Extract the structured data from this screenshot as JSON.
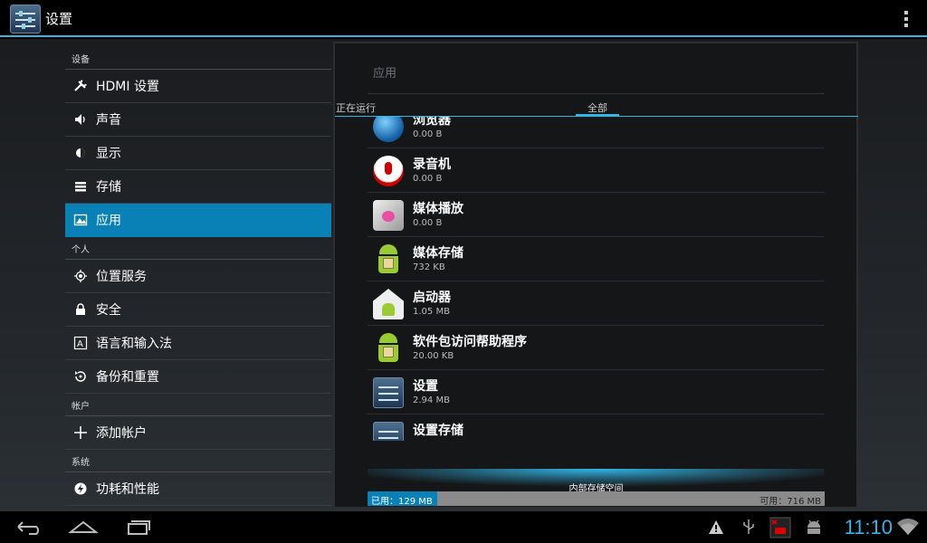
{
  "action_bar": {
    "title": "设置"
  },
  "left_list": {
    "sections": [
      {
        "header": "设备",
        "items": [
          {
            "label": "HDMI 设置",
            "icon": "wrench-icon"
          },
          {
            "label": "声音",
            "icon": "speaker-icon"
          },
          {
            "label": "显示",
            "icon": "brightness-icon"
          },
          {
            "label": "存储",
            "icon": "storage-icon"
          },
          {
            "label": "应用",
            "icon": "apps-icon",
            "selected": true
          }
        ]
      },
      {
        "header": "个人",
        "items": [
          {
            "label": "位置服务",
            "icon": "location-icon"
          },
          {
            "label": "安全",
            "icon": "lock-icon"
          },
          {
            "label": "语言和输入法",
            "icon": "language-icon"
          },
          {
            "label": "备份和重置",
            "icon": "backup-icon"
          }
        ]
      },
      {
        "header": "帐户",
        "items": [
          {
            "label": "添加帐户",
            "icon": "plus-icon"
          }
        ]
      },
      {
        "header": "系统",
        "items": [
          {
            "label": "功耗和性能",
            "icon": "power-icon"
          }
        ]
      }
    ]
  },
  "panel": {
    "title": "应用",
    "tabs": [
      {
        "label": "正在运行"
      },
      {
        "label": "全部",
        "selected": true
      }
    ],
    "apps": [
      {
        "name": "浏览器",
        "size": "0.00 B",
        "icon": "browser-icon"
      },
      {
        "name": "录音机",
        "size": "0.00 B",
        "icon": "recorder-icon"
      },
      {
        "name": "媒体播放",
        "size": "0.00 B",
        "icon": "media-player-icon"
      },
      {
        "name": "媒体存储",
        "size": "732 KB",
        "icon": "android-icon"
      },
      {
        "name": "启动器",
        "size": "1.05 MB",
        "icon": "launcher-icon"
      },
      {
        "name": "软件包访问帮助程序",
        "size": "20.00 KB",
        "icon": "android-icon"
      },
      {
        "name": "设置",
        "size": "2.94 MB",
        "icon": "settings-icon"
      },
      {
        "name": "设置存储",
        "size": "",
        "icon": "settings-icon"
      }
    ],
    "storage": {
      "label": "内部存储空间",
      "used": "已用：129 MB",
      "free": "可用：716 MB",
      "used_fraction": 0.153
    }
  },
  "nav_bar": {
    "clock": "11:10"
  },
  "colors": {
    "accent": "#33b5e5",
    "selected": "#0a81b6"
  }
}
